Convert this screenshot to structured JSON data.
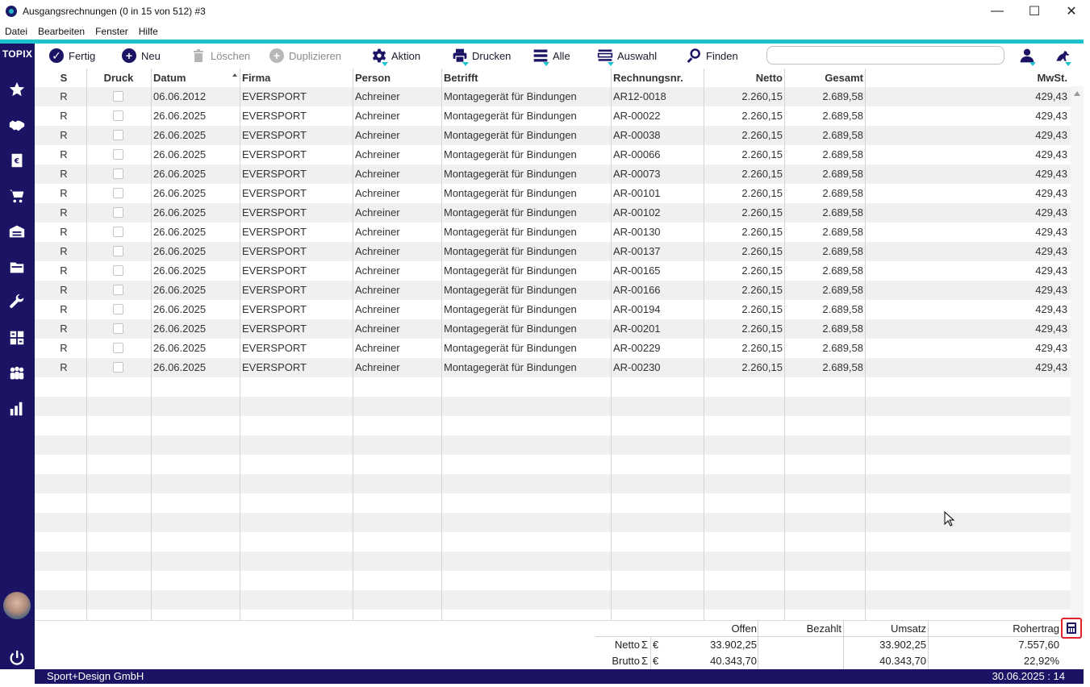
{
  "window": {
    "title": "Ausgangsrechnungen (0 in 15 von 512) #3",
    "controls": {
      "minimize": "—",
      "maximize": "☐",
      "close": "✕"
    }
  },
  "menu": [
    "Datei",
    "Bearbeiten",
    "Fenster",
    "Hilfe"
  ],
  "brand": "TOPIX",
  "toolbar": {
    "fertig": "Fertig",
    "neu": "Neu",
    "loeschen": "Löschen",
    "duplizieren": "Duplizieren",
    "aktion": "Aktion",
    "drucken": "Drucken",
    "alle": "Alle",
    "auswahl": "Auswahl",
    "finden": "Finden",
    "search_value": ""
  },
  "columns": {
    "s": "S",
    "druck": "Druck",
    "datum": "Datum",
    "firma": "Firma",
    "person": "Person",
    "betrifft": "Betrifft",
    "rechnungsnr": "Rechnungsnr.",
    "netto": "Netto",
    "gesamt": "Gesamt",
    "mwst": "MwSt."
  },
  "rows": [
    {
      "s": "R",
      "druck": false,
      "datum": "06.06.2012",
      "firma": "EVERSPORT",
      "person": "Achreiner",
      "betrifft": "Montagegerät für Bindungen",
      "nr": "AR12-0018",
      "netto": "2.260,15",
      "gesamt": "2.689,58",
      "mwst": "429,43"
    },
    {
      "s": "R",
      "druck": false,
      "datum": "26.06.2025",
      "firma": "EVERSPORT",
      "person": "Achreiner",
      "betrifft": "Montagegerät für Bindungen",
      "nr": "AR-00022",
      "netto": "2.260,15",
      "gesamt": "2.689,58",
      "mwst": "429,43"
    },
    {
      "s": "R",
      "druck": false,
      "datum": "26.06.2025",
      "firma": "EVERSPORT",
      "person": "Achreiner",
      "betrifft": "Montagegerät für Bindungen",
      "nr": "AR-00038",
      "netto": "2.260,15",
      "gesamt": "2.689,58",
      "mwst": "429,43"
    },
    {
      "s": "R",
      "druck": false,
      "datum": "26.06.2025",
      "firma": "EVERSPORT",
      "person": "Achreiner",
      "betrifft": "Montagegerät für Bindungen",
      "nr": "AR-00066",
      "netto": "2.260,15",
      "gesamt": "2.689,58",
      "mwst": "429,43"
    },
    {
      "s": "R",
      "druck": false,
      "datum": "26.06.2025",
      "firma": "EVERSPORT",
      "person": "Achreiner",
      "betrifft": "Montagegerät für Bindungen",
      "nr": "AR-00073",
      "netto": "2.260,15",
      "gesamt": "2.689,58",
      "mwst": "429,43"
    },
    {
      "s": "R",
      "druck": false,
      "datum": "26.06.2025",
      "firma": "EVERSPORT",
      "person": "Achreiner",
      "betrifft": "Montagegerät für Bindungen",
      "nr": "AR-00101",
      "netto": "2.260,15",
      "gesamt": "2.689,58",
      "mwst": "429,43"
    },
    {
      "s": "R",
      "druck": false,
      "datum": "26.06.2025",
      "firma": "EVERSPORT",
      "person": "Achreiner",
      "betrifft": "Montagegerät für Bindungen",
      "nr": "AR-00102",
      "netto": "2.260,15",
      "gesamt": "2.689,58",
      "mwst": "429,43"
    },
    {
      "s": "R",
      "druck": false,
      "datum": "26.06.2025",
      "firma": "EVERSPORT",
      "person": "Achreiner",
      "betrifft": "Montagegerät für Bindungen",
      "nr": "AR-00130",
      "netto": "2.260,15",
      "gesamt": "2.689,58",
      "mwst": "429,43"
    },
    {
      "s": "R",
      "druck": false,
      "datum": "26.06.2025",
      "firma": "EVERSPORT",
      "person": "Achreiner",
      "betrifft": "Montagegerät für Bindungen",
      "nr": "AR-00137",
      "netto": "2.260,15",
      "gesamt": "2.689,58",
      "mwst": "429,43"
    },
    {
      "s": "R",
      "druck": false,
      "datum": "26.06.2025",
      "firma": "EVERSPORT",
      "person": "Achreiner",
      "betrifft": "Montagegerät für Bindungen",
      "nr": "AR-00165",
      "netto": "2.260,15",
      "gesamt": "2.689,58",
      "mwst": "429,43"
    },
    {
      "s": "R",
      "druck": false,
      "datum": "26.06.2025",
      "firma": "EVERSPORT",
      "person": "Achreiner",
      "betrifft": "Montagegerät für Bindungen",
      "nr": "AR-00166",
      "netto": "2.260,15",
      "gesamt": "2.689,58",
      "mwst": "429,43"
    },
    {
      "s": "R",
      "druck": false,
      "datum": "26.06.2025",
      "firma": "EVERSPORT",
      "person": "Achreiner",
      "betrifft": "Montagegerät für Bindungen",
      "nr": "AR-00194",
      "netto": "2.260,15",
      "gesamt": "2.689,58",
      "mwst": "429,43"
    },
    {
      "s": "R",
      "druck": false,
      "datum": "26.06.2025",
      "firma": "EVERSPORT",
      "person": "Achreiner",
      "betrifft": "Montagegerät für Bindungen",
      "nr": "AR-00201",
      "netto": "2.260,15",
      "gesamt": "2.689,58",
      "mwst": "429,43"
    },
    {
      "s": "R",
      "druck": false,
      "datum": "26.06.2025",
      "firma": "EVERSPORT",
      "person": "Achreiner",
      "betrifft": "Montagegerät für Bindungen",
      "nr": "AR-00229",
      "netto": "2.260,15",
      "gesamt": "2.689,58",
      "mwst": "429,43"
    },
    {
      "s": "R",
      "druck": false,
      "datum": "26.06.2025",
      "firma": "EVERSPORT",
      "person": "Achreiner",
      "betrifft": "Montagegerät für Bindungen",
      "nr": "AR-00230",
      "netto": "2.260,15",
      "gesamt": "2.689,58",
      "mwst": "429,43"
    }
  ],
  "summary": {
    "headers": {
      "offen": "Offen",
      "bezahlt": "Bezahlt",
      "umsatz": "Umsatz",
      "rohertrag": "Rohertrag"
    },
    "netto": {
      "label": "Netto",
      "sigma": "Σ",
      "currency": "€",
      "offen": "33.902,25",
      "bezahlt": "",
      "umsatz": "33.902,25",
      "rohertrag": "7.557,60"
    },
    "brutto": {
      "label": "Brutto",
      "sigma": "Σ",
      "currency": "€",
      "offen": "40.343,70",
      "bezahlt": "",
      "umsatz": "40.343,70",
      "rohertrag": "22,92%"
    }
  },
  "status": {
    "company": "Sport+Design GmbH",
    "datetime": "30.06.2025 : 14"
  },
  "sidebar_icons": [
    "star-icon",
    "handshake-icon",
    "invoice-icon",
    "cart-icon",
    "warehouse-icon",
    "folder-icon",
    "wrench-icon",
    "calculator-icon",
    "people-icon",
    "chart-icon"
  ],
  "colors": {
    "sidebar": "#1b1464",
    "accent": "#1ec2cf",
    "highlight": "#e0222e"
  }
}
